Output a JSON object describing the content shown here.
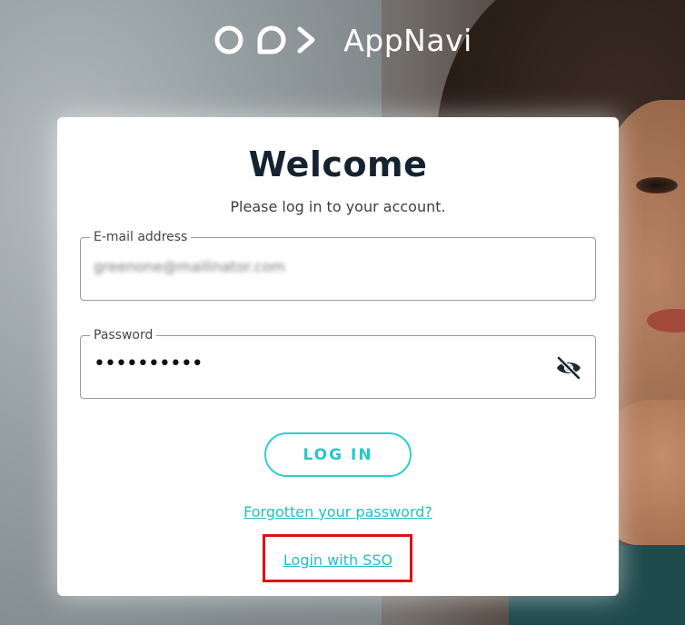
{
  "brand": {
    "name": "AppNavi"
  },
  "login": {
    "title": "Welcome",
    "subtitle": "Please log in to your account.",
    "email_label": "E-mail address",
    "email_value": "greenone@mailinator.com",
    "password_label": "Password",
    "password_value": "••••••••••",
    "login_button": "LOG IN",
    "forgot_link": "Forgotten your password?",
    "sso_link": "Login with SSO"
  },
  "colors": {
    "accent": "#26c6cc",
    "title": "#14232f",
    "highlight": "#e01010"
  },
  "icons": {
    "password_toggle": "eye-slash-icon",
    "logo": "appnavi-logo-icon"
  }
}
